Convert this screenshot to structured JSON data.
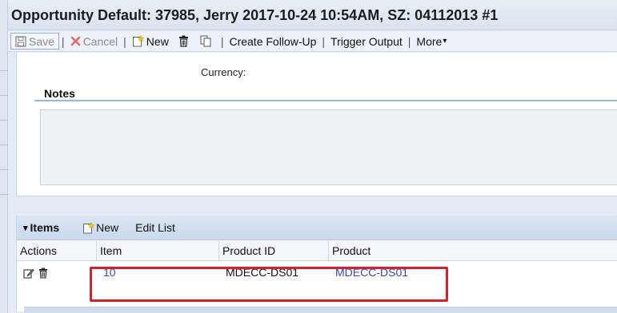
{
  "window": {
    "title": "Opportunity Default: 37985, Jerry 2017-10-24 10:54AM, SZ: 04112013 #1"
  },
  "toolbar": {
    "save_label": "Save",
    "cancel_label": "Cancel",
    "new_label": "New",
    "sep": "|",
    "create_followup_label": "Create Follow-Up",
    "trigger_output_label": "Trigger Output",
    "more_label": "More",
    "more_arrow": "▾",
    "icons": [
      "save-icon",
      "cancel-x-icon",
      "new-document-icon",
      "trash-icon",
      "copy-icon",
      "dropdown-arrow-icon"
    ]
  },
  "form": {
    "currency_label": "Currency:",
    "notes_label": "Notes",
    "notes_value": ""
  },
  "items": {
    "toggle_arrow": "▾",
    "title": "Items",
    "new_label": "New",
    "edit_list_label": "Edit List",
    "columns": [
      "Actions",
      "Item",
      "Product ID",
      "Product"
    ],
    "rows": [
      {
        "item": "10",
        "product_id": "MDECC-DS01",
        "product": "MDECC-DS01"
      }
    ]
  },
  "colors": {
    "highlight": "#d6202c",
    "link": "#3445b5",
    "header_blue": "#cad9ee"
  }
}
